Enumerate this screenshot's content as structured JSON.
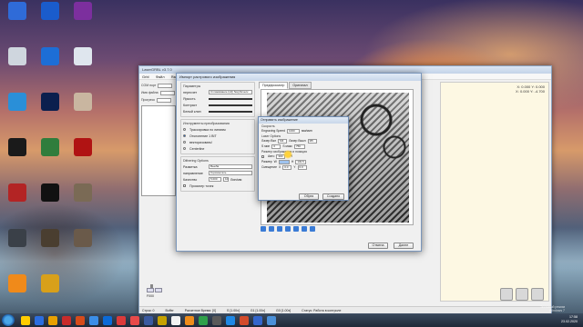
{
  "desktop": {
    "icons": [
      {
        "label": "",
        "color": "#2f6bd8"
      },
      {
        "label": "",
        "color": "#1a5ccc"
      },
      {
        "label": "",
        "color": "#7c2f9e"
      },
      {
        "label": "",
        "color": "#cfd6de"
      },
      {
        "label": "",
        "color": "#1d6ed6"
      },
      {
        "label": "",
        "color": "#dfe6ee"
      },
      {
        "label": "",
        "color": "#2a8fd8"
      },
      {
        "label": "",
        "color": "#0b1f4e"
      },
      {
        "label": "",
        "color": "#c9b6a0"
      },
      {
        "label": "",
        "color": "#1a1a1a"
      },
      {
        "label": "",
        "color": "#2f7d3c"
      },
      {
        "label": "",
        "color": "#b01313"
      },
      {
        "label": "",
        "color": "#b32424"
      },
      {
        "label": "",
        "color": "#111"
      },
      {
        "label": "",
        "color": "#7a6a55"
      },
      {
        "label": "",
        "color": "#3a4048"
      },
      {
        "label": "",
        "color": "#4a3e30"
      },
      {
        "label": "",
        "color": "#6a5a4a"
      },
      {
        "label": "",
        "color": "#f08a1a"
      },
      {
        "label": "",
        "color": "#d8a01a"
      }
    ]
  },
  "main_window": {
    "title": "LaserGRBL v3.7.0",
    "menu": [
      "Grbl",
      "Файл",
      "Язык",
      "Справка"
    ],
    "com_label": "COM порт",
    "baud_label": "Скорость",
    "file_label": "Имя файла",
    "progress_label": "Прогресс",
    "coords": [
      "X: 0.000 Y: 0.000",
      "X: 0.000 Y: -4.700"
    ],
    "status_items": [
      "Строк: 0",
      "Buffer",
      "Расчетное Время: [0]",
      "Статус: Работа в контроле"
    ],
    "zoom_items": [
      "S [1.00x]",
      "G1 [1.00x]",
      "G0 [1.00x]",
      "S [1.00x]"
    ],
    "fps_label": "F000"
  },
  "import_window": {
    "title": "Импорт растрового изображения",
    "groups": {
      "params": "Параметры",
      "tools": "Инструменты преобразования",
      "dithering": "Dithering Options"
    },
    "params": {
      "resize_label": "пересчет",
      "resize_value": "Сглаживание (HQ бикубическ",
      "brightness_label": "Яркость",
      "contrast_label": "Контраст",
      "whiteclip_label": "Белый клип"
    },
    "tools": {
      "opt1": "Трассировка по линиям",
      "opt2": "Отклонение 1 BIT",
      "opt3": "векторизовать!",
      "opt4": "Centerline"
    },
    "dithering": {
      "resolution_label": "Разметка",
      "resolution_value": "Вьюба",
      "direction_label": "направление",
      "direction_value": "Горизонталь",
      "quality_label": "Качество",
      "quality_value": "5.000",
      "linepref_label": "Лин/мм",
      "linepref_value": "10",
      "preview_label": "Просмотр точек"
    },
    "tabs": [
      "Предпросмотр",
      "Оригинал"
    ],
    "cancel_button": "Отмена",
    "next_button": "Далее"
  },
  "send_dialog": {
    "title": "Отправить изображение",
    "speed_section": "Скорость",
    "engraving_speed_label": "Engraving Speed",
    "engraving_speed_value": "1000",
    "speed_unit": "мм/мин",
    "laser_section": "Laser Options",
    "laser_on_label": "Лазер Вкл",
    "laser_on_value": "M3",
    "laser_off_label": "Лазер Выкл",
    "laser_off_value": "M5",
    "smin_label": "S мин",
    "smin_value": "0",
    "smax_label": "S макс",
    "smax_value": "750",
    "size_section": "Размер изображения и позиция",
    "auto_label": "Авто",
    "dpi_value": "300",
    "dpi_label": "DPI",
    "size_label": "Размер",
    "size_w_label": "W",
    "size_w_value": "",
    "size_h_label": "H",
    "size_h_value": "130.5",
    "offset_label": "Смещение",
    "offset_x_label": "X",
    "offset_x_value": "0.0",
    "offset_y_label": "Y",
    "offset_y_value": "0.0",
    "back_button": "Обрез",
    "create_button": "Создано"
  },
  "taskbar": {
    "icons": [
      {
        "color": "#ffcc00"
      },
      {
        "color": "#2b6de0"
      },
      {
        "color": "#e8a000"
      },
      {
        "color": "#c82b2b"
      },
      {
        "color": "#d64b1a"
      },
      {
        "color": "#3b8ee8"
      },
      {
        "color": "#0a6ad8"
      },
      {
        "color": "#dc3a3a"
      },
      {
        "color": "#e84a4a"
      },
      {
        "color": "#3a5aa0"
      },
      {
        "color": "#c6a200"
      },
      {
        "color": "#f2f2f2"
      },
      {
        "color": "#ef8c1a"
      },
      {
        "color": "#2fa04a"
      },
      {
        "color": "#5a5a5a"
      },
      {
        "color": "#1e88e5"
      },
      {
        "color": "#d24b2b"
      },
      {
        "color": "#3366cc"
      },
      {
        "color": "#4a90d9"
      }
    ],
    "time": "17:58",
    "date": "23.02.2020",
    "watermark_line1": "Тестовый режим",
    "watermark_line2": "Windows 7"
  }
}
